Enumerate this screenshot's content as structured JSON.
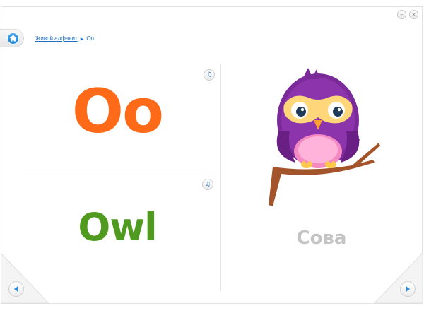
{
  "breadcrumb": {
    "root": "Живой алфавит",
    "current": "Оо"
  },
  "card": {
    "letter": "Oo",
    "word": "Owl",
    "translation": "Сова",
    "colors": {
      "letter": "#ff6a18",
      "word": "#4f9a1f",
      "translation": "#c4c4c4",
      "accent": "#1f6fc4"
    }
  },
  "icons": {
    "home": "home-icon",
    "sound": "speaker-music-icon",
    "prev": "arrow-left-icon",
    "next": "arrow-right-icon",
    "minimize": "minimize-icon",
    "close": "close-icon"
  }
}
